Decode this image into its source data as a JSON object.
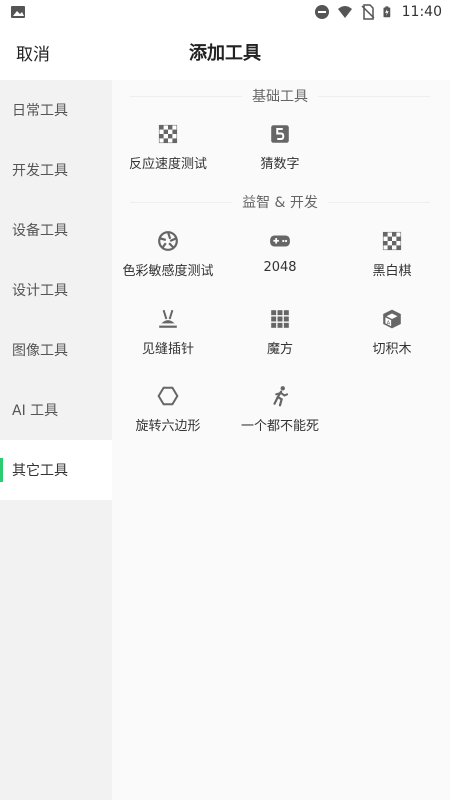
{
  "status_bar": {
    "time": "11:40",
    "icons": [
      "image-icon",
      "dnd-icon",
      "wifi-icon",
      "no-sim-icon",
      "battery-charging-icon"
    ]
  },
  "header": {
    "cancel_label": "取消",
    "title": "添加工具"
  },
  "sidebar": {
    "items": [
      {
        "label": "日常工具",
        "active": false
      },
      {
        "label": "开发工具",
        "active": false
      },
      {
        "label": "设备工具",
        "active": false
      },
      {
        "label": "设计工具",
        "active": false
      },
      {
        "label": "图像工具",
        "active": false
      },
      {
        "label": "AI 工具",
        "active": false
      },
      {
        "label": "其它工具",
        "active": true
      }
    ]
  },
  "sections": [
    {
      "title": "基础工具",
      "tools": [
        {
          "label": "反应速度测试",
          "icon": "checkerboard-icon"
        },
        {
          "label": "猜数字",
          "icon": "number-five-icon"
        }
      ]
    },
    {
      "title": "益智 & 开发",
      "tools": [
        {
          "label": "色彩敏感度测试",
          "icon": "aperture-icon"
        },
        {
          "label": "2048",
          "icon": "gamepad-icon"
        },
        {
          "label": "黑白棋",
          "icon": "checkerboard-icon"
        },
        {
          "label": "见缝插针",
          "icon": "pin-icon"
        },
        {
          "label": "魔方",
          "icon": "grid-icon"
        },
        {
          "label": "切积木",
          "icon": "block-cube-icon"
        },
        {
          "label": "旋转六边形",
          "icon": "hexagon-icon"
        },
        {
          "label": "一个都不能死",
          "icon": "running-man-icon"
        }
      ]
    }
  ],
  "colors": {
    "accent": "#2ecc71",
    "sidebar_bg": "#f2f2f2",
    "main_bg": "#fafafa"
  }
}
